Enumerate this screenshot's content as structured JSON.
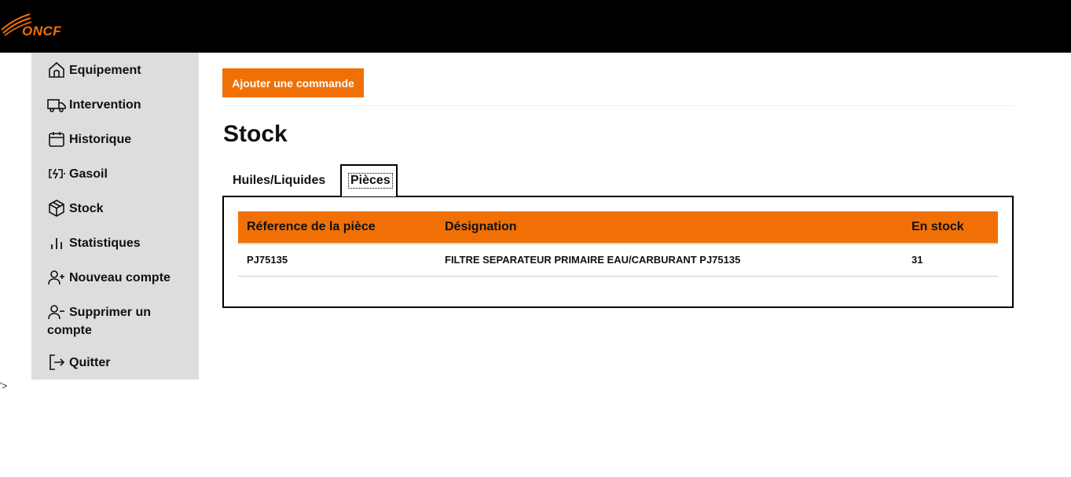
{
  "header": {
    "logo_text": "ONCF"
  },
  "sidebar": {
    "items": [
      {
        "label": "Equipement",
        "icon": "home-icon"
      },
      {
        "label": "Intervention",
        "icon": "truck-icon"
      },
      {
        "label": "Historique",
        "icon": "calendar-icon"
      },
      {
        "label": "Gasoil",
        "icon": "battery-charging-icon"
      },
      {
        "label": "Stock",
        "icon": "box-icon"
      },
      {
        "label": "Statistiques",
        "icon": "bar-chart-icon"
      },
      {
        "label": "Nouveau compte",
        "icon": "user-plus-icon"
      },
      {
        "label": "Supprimer un compte",
        "icon": "user-minus-icon"
      },
      {
        "label": "Quitter",
        "icon": "logout-icon"
      }
    ]
  },
  "stray_text": "'>",
  "main": {
    "add_button_label": "Ajouter une commande",
    "title": "Stock",
    "tabs": [
      {
        "label": "Huiles/Liquides",
        "active": false
      },
      {
        "label": "Pièces",
        "active": true
      }
    ],
    "table": {
      "headers": [
        "Réference de la pièce",
        "Désignation",
        "En stock"
      ],
      "rows": [
        [
          "PJ75135",
          "FILTRE SEPARATEUR PRIMAIRE EAU/CARBURANT PJ75135",
          "31"
        ]
      ]
    }
  },
  "colors": {
    "accent": "#f07006",
    "sidebar_bg": "#dddddd",
    "header_bg": "#000000"
  }
}
